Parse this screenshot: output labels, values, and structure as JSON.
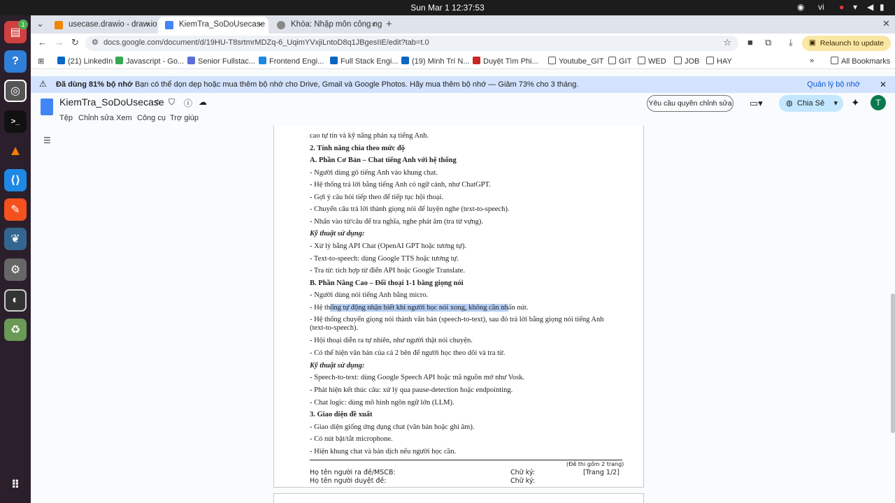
{
  "system": {
    "clock": "Sun Mar 1  12:37:53",
    "lang": "vi"
  },
  "tabs": [
    {
      "title": "usecase.drawio - draw.io",
      "close": "×"
    },
    {
      "title": "KiemTra_SoDoUsecase",
      "close": "×"
    },
    {
      "title": "Khóa: Nhập môn công ng",
      "close": "×"
    }
  ],
  "new_tab": "+",
  "address": {
    "url": "docs.google.com/document/d/19HU-T8srtmrMDZq-6_UqimYVxjiLntoD8q1JBgesIIE/edit?tab=t.0"
  },
  "relaunch": "Relaunch to update",
  "avatar_letter": "T",
  "bookmarks": [
    "(21) LinkedIn",
    "Javascript - Go...",
    "Senior Fullstac...",
    "Frontend Engi...",
    "Full Stack Engi...",
    "(19) Minh Trí N...",
    "Duyệt Tìm Phi...",
    "Youtube_GIT",
    "GIT",
    "WED",
    "JOB",
    "HAY"
  ],
  "all_bookmarks": "All Bookmarks",
  "banner": {
    "bold": "Đã dùng 81% bộ nhớ",
    "text": " Bạn có thể dọn dẹp hoặc mua thêm bộ nhớ cho Drive, Gmail và Google Photos. Hãy mua thêm bộ nhớ — Giảm 73% cho 3 tháng.",
    "manage": "Quản lý bộ nhớ"
  },
  "doc": {
    "title": "KiemTra_SoDoUsecase",
    "menus": [
      "Tệp",
      "Chỉnh sửa",
      "Xem",
      "Công cụ",
      "Trợ giúp"
    ],
    "request_edit": "Yêu cầu quyền chỉnh sửa",
    "share": "Chia Sẻ"
  },
  "content": {
    "l0": "cao tự tin và kỹ năng phản xạ tiếng Anh.",
    "l1": "2. Tính năng chia theo mức độ",
    "l2": "A. Phần Cơ Bản – Chat tiếng Anh với hệ thống",
    "l3": "- Người dùng gõ tiếng Anh vào khung chat.",
    "l4": "- Hệ thống trả lời bằng tiếng Anh có ngữ cảnh, như ChatGPT.",
    "l5": "- Gợi ý câu hỏi tiếp theo để tiếp tục hội thoại.",
    "l6": "- Chuyển câu trả lời thành giọng nói để luyện nghe (text-to-speech).",
    "l7": "- Nhấn vào từ/câu để tra nghĩa, nghe phát âm (tra từ vựng).",
    "l8": "Kỹ thuật sử dụng:",
    "l9": "- Xử lý bằng API Chat (OpenAI GPT hoặc tương tự).",
    "l10": "- Text-to-speech: dùng Google TTS hoặc tương tự.",
    "l11": "- Tra từ: tích hợp từ điển API hoặc Google Translate.",
    "l12": "B. Phần Nâng Cao – Đối thoại 1-1 bằng giọng nói",
    "l13": "- Người dùng nói tiếng Anh bằng micro.",
    "l14a": "- Hệ th",
    "l14b": "ống tự động nhận biết khi người học nói xong, không cần nh",
    "l14c": "ấn nút.",
    "l15": "- Hệ thống chuyển giọng nói thành văn bản (speech-to-text), sau đó trả lời bằng giọng nói tiếng Anh",
    "l15b": "(text-to-speech).",
    "l16": "- Hội thoại diễn ra tự nhiên, như người thật nói chuyện.",
    "l17": "- Có thể hiện văn bản của cả 2 bên để người học theo dõi và tra từ.",
    "l18": "Kỹ thuật sử dụng:",
    "l19": "- Speech-to-text: dùng Google Speech API hoặc mã nguồn mở như Vosk.",
    "l20": "- Phát hiện kết thúc câu: xử lý qua pause-detection hoặc endpointing.",
    "l21": "- Chat logic: dùng mô hình ngôn ngữ lớn (LLM).",
    "l22": "3. Giao diện đề xuất",
    "l23": "- Giao diện giống ứng dụng chat (văn bản hoặc ghi âm).",
    "l24": "- Có nút bật/tắt microphone.",
    "l25": "- Hiện khung chat và bản dịch nếu người học cần."
  },
  "footer": {
    "note": "(Đề thi gồm 2 trang)",
    "author": "Họ tên người ra đề/MSCB:",
    "reviewer": "Họ tên người duyệt đề:",
    "sign1": "Chữ ký:",
    "sign2": "Chữ ký:",
    "page": "[Trang 1/2]"
  }
}
